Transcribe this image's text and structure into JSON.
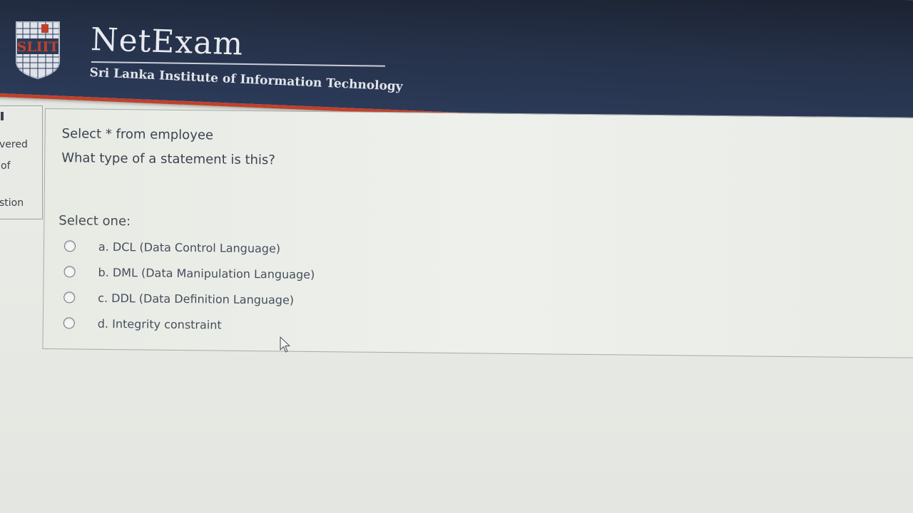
{
  "header": {
    "logo_text": "SLIIT",
    "title": "NetExam",
    "subtitle": "Sri Lanka Institute of Information Technology"
  },
  "sidebar_info": {
    "lines": [
      "vered",
      "of",
      "stion"
    ]
  },
  "question": {
    "line1": "Select * from employee",
    "line2": "What type of a statement is this?",
    "prompt": "Select one:",
    "options": [
      {
        "label": "a. DCL (Data Control Language)",
        "selected": false
      },
      {
        "label": "b. DML (Data Manipulation Language)",
        "selected": false
      },
      {
        "label": "c. DDL (Data Definition Language)",
        "selected": false
      },
      {
        "label": "d. Integrity constraint",
        "selected": false
      }
    ]
  },
  "colors": {
    "header_bg": "#26324a",
    "header_accent": "#c0412b",
    "page_bg": "#e6e8e4",
    "text": "#3b4350"
  },
  "icons": {
    "logo": "sliit-logo-icon",
    "cursor": "mouse-pointer-icon",
    "radio": "radio-button-icon"
  }
}
